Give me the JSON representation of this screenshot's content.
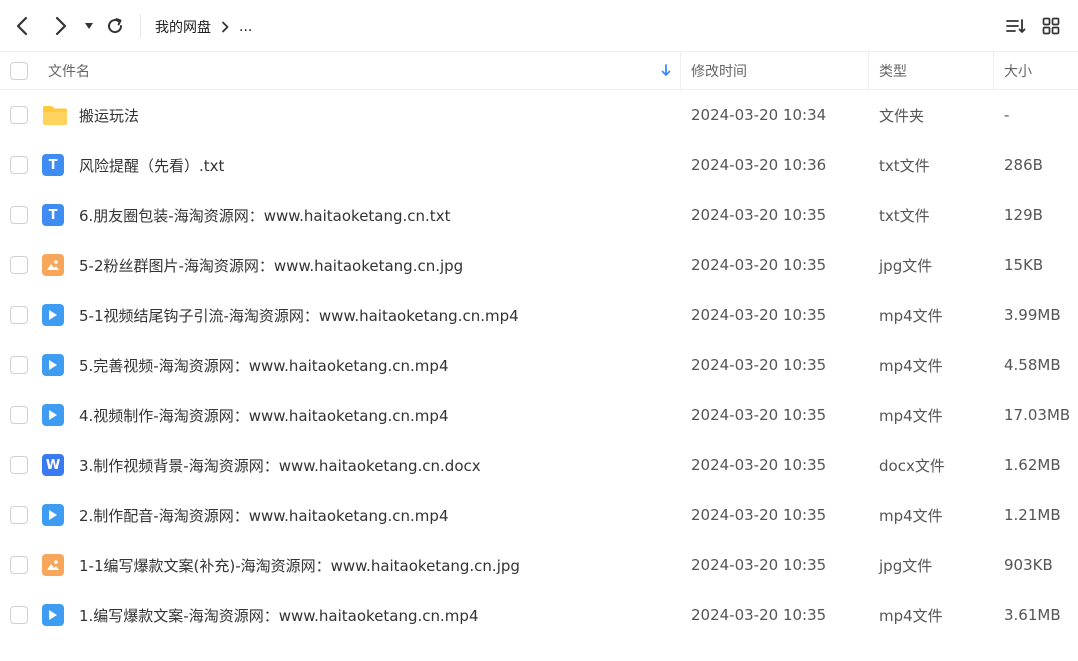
{
  "toolbar": {
    "breadcrumbs": [
      "我的网盘",
      "..."
    ]
  },
  "columns": {
    "name": "文件名",
    "modified": "修改时间",
    "type": "类型",
    "size": "大小"
  },
  "files": [
    {
      "icon": "folder-icon",
      "name": "搬运玩法",
      "date": "2024-03-20 10:34",
      "type": "文件夹",
      "size": "-"
    },
    {
      "icon": "txt-file-icon",
      "name": "风险提醒（先看）.txt",
      "date": "2024-03-20 10:36",
      "type": "txt文件",
      "size": "286B"
    },
    {
      "icon": "txt-file-icon",
      "name": "6.朋友圈包装-海淘资源网：www.haitaoketang.cn.txt",
      "date": "2024-03-20 10:35",
      "type": "txt文件",
      "size": "129B"
    },
    {
      "icon": "image-file-icon",
      "name": "5-2粉丝群图片-海淘资源网：www.haitaoketang.cn.jpg",
      "date": "2024-03-20 10:35",
      "type": "jpg文件",
      "size": "15KB"
    },
    {
      "icon": "video-file-icon",
      "name": "5-1视频结尾钩子引流-海淘资源网：www.haitaoketang.cn.mp4",
      "date": "2024-03-20 10:35",
      "type": "mp4文件",
      "size": "3.99MB"
    },
    {
      "icon": "video-file-icon",
      "name": "5.完善视频-海淘资源网：www.haitaoketang.cn.mp4",
      "date": "2024-03-20 10:35",
      "type": "mp4文件",
      "size": "4.58MB"
    },
    {
      "icon": "video-file-icon",
      "name": "4.视频制作-海淘资源网：www.haitaoketang.cn.mp4",
      "date": "2024-03-20 10:35",
      "type": "mp4文件",
      "size": "17.03MB"
    },
    {
      "icon": "word-file-icon",
      "name": "3.制作视频背景-海淘资源网：www.haitaoketang.cn.docx",
      "date": "2024-03-20 10:35",
      "type": "docx文件",
      "size": "1.62MB"
    },
    {
      "icon": "video-file-icon",
      "name": "2.制作配音-海淘资源网：www.haitaoketang.cn.mp4",
      "date": "2024-03-20 10:35",
      "type": "mp4文件",
      "size": "1.21MB"
    },
    {
      "icon": "image-file-icon",
      "name": "1-1编写爆款文案(补充)-海淘资源网：www.haitaoketang.cn.jpg",
      "date": "2024-03-20 10:35",
      "type": "jpg文件",
      "size": "903KB"
    },
    {
      "icon": "video-file-icon",
      "name": "1.编写爆款文案-海淘资源网：www.haitaoketang.cn.mp4",
      "date": "2024-03-20 10:35",
      "type": "mp4文件",
      "size": "3.61MB"
    }
  ],
  "colors": {
    "accent": "#3f8cf3",
    "folder": "#ffc83d",
    "image": "#f7a65a"
  }
}
